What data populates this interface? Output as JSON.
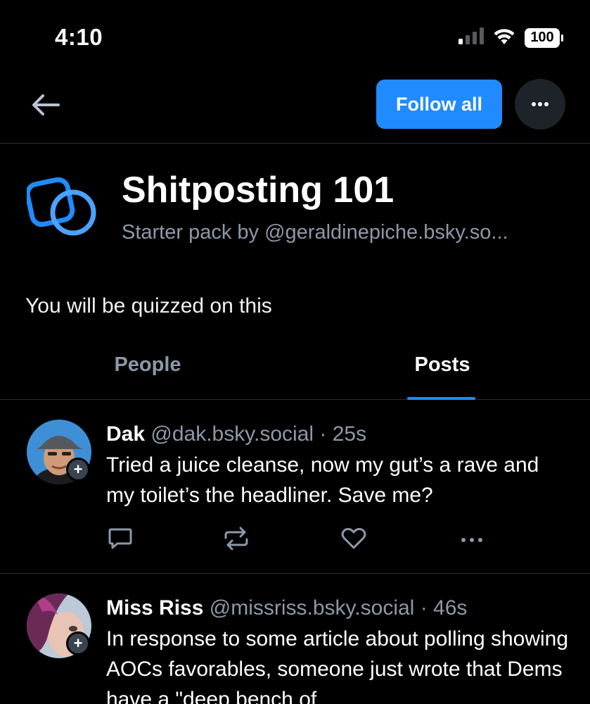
{
  "status_bar": {
    "time": "4:10",
    "battery": "100"
  },
  "nav": {
    "follow_all_label": "Follow all",
    "back_icon": "arrow-left-icon",
    "more_icon": "ellipsis-icon"
  },
  "pack": {
    "title": "Shitposting 101",
    "subtitle": "Starter pack by @geraldinepiche.bsky.so...",
    "description": "You will be quizzed on this",
    "logo_icon": "starter-pack-icon"
  },
  "tabs": [
    {
      "label": "People",
      "active": false
    },
    {
      "label": "Posts",
      "active": true
    }
  ],
  "posts": [
    {
      "name": "Dak",
      "handle": "@dak.bsky.social",
      "dot": "·",
      "time": "25s",
      "text": "Tried a juice cleanse, now my gut’s a rave and my toilet’s the headliner. Save me?"
    },
    {
      "name": "Miss Riss",
      "handle": "@missriss.bsky.social",
      "dot": "·",
      "time": "46s",
      "text": "In response to some article about polling showing AOCs favorables, someone just wrote that Dems have a \"deep bench of"
    }
  ],
  "avatar_badge": "+",
  "colors": {
    "accent": "#208bfe",
    "muted": "#8d98a8",
    "background": "#000000",
    "divider": "#2a2f37"
  }
}
